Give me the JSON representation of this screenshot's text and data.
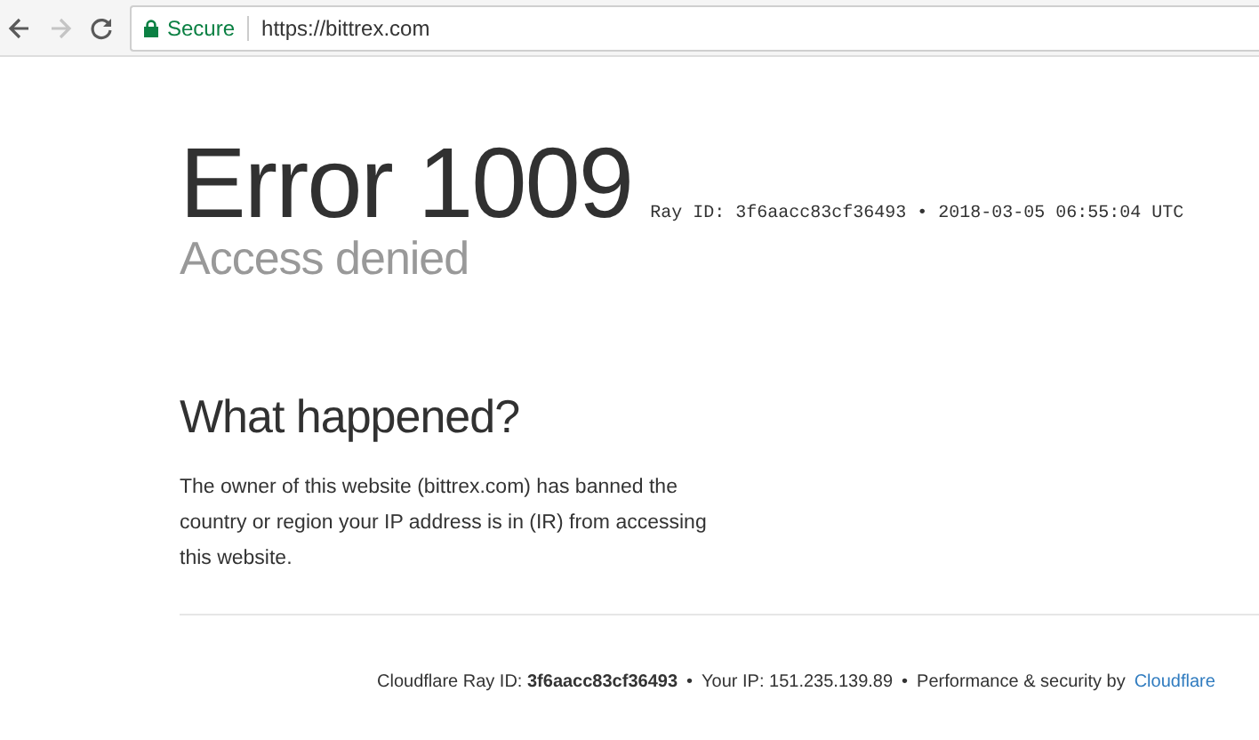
{
  "browser": {
    "back_disabled": false,
    "forward_disabled": true,
    "security_label": "Secure",
    "url": "https://bittrex.com"
  },
  "error": {
    "title": "Error 1009",
    "ray_line": "Ray ID: 3f6aacc83cf36493 • 2018-03-05 06:55:04 UTC",
    "subtitle": "Access denied"
  },
  "what_happened": {
    "heading": "What happened?",
    "text": "The owner of this website (bittrex.com) has banned the country or region your IP address is in (IR) from accessing this website."
  },
  "footer": {
    "ray_id": "Cloudflare Ray ID: **3f6aacc83cf36493**",
    "separator_1": "•",
    "ip": "Your IP: 151.235.139.89",
    "separator_2": "•",
    "performance": "Performance & security by",
    "link": "Cloudflare"
  }
}
